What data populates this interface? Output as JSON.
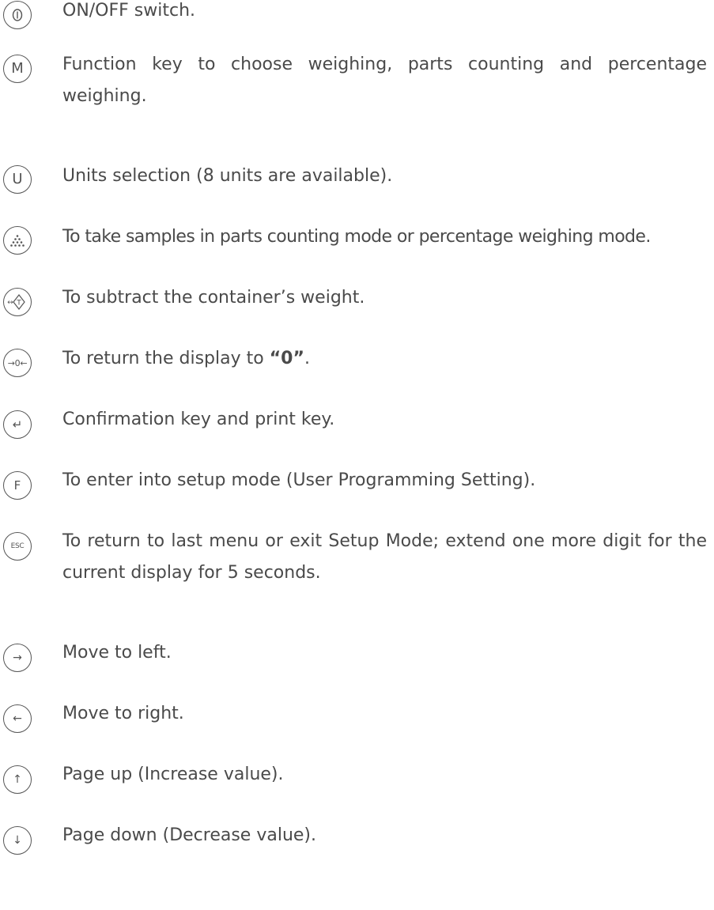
{
  "keys": [
    {
      "icon": "power-icon",
      "icon_text": "",
      "text": "ON/OFF switch."
    },
    {
      "icon": "mode-icon",
      "icon_text": "M",
      "text": "Function key to choose weighing, parts counting and percentage weighing."
    },
    {
      "icon": "units-icon",
      "icon_text": "U",
      "text": "Units selection (8 units are available)."
    },
    {
      "icon": "sample-icon",
      "icon_text": "",
      "text": "To take samples in parts counting mode or percentage weighing mode."
    },
    {
      "icon": "tare-icon",
      "icon_text": "",
      "text": "To subtract the container’s weight."
    },
    {
      "icon": "zero-icon",
      "icon_text": "→0←",
      "text_before": "To return the display to ",
      "text_bold": "“0”",
      "text_after": "."
    },
    {
      "icon": "enter-icon",
      "icon_text": "↵",
      "text": "Confirmation key and print key."
    },
    {
      "icon": "function-icon",
      "icon_text": "F",
      "text": "To enter into setup mode (User Programming Setting)."
    },
    {
      "icon": "escape-icon",
      "icon_text": "ESC",
      "text": "To return to last menu or exit Setup Mode; extend one more digit for the current display for 5 seconds."
    },
    {
      "icon": "arrow-right-icon",
      "icon_text": "→",
      "text": "Move to left."
    },
    {
      "icon": "arrow-left-icon",
      "icon_text": "←",
      "text": "Move to right."
    },
    {
      "icon": "arrow-up-icon",
      "icon_text": "↑",
      "text": "Page up (Increase value)."
    },
    {
      "icon": "arrow-down-icon",
      "icon_text": "↓",
      "text": "Page down (Decrease value)."
    }
  ]
}
